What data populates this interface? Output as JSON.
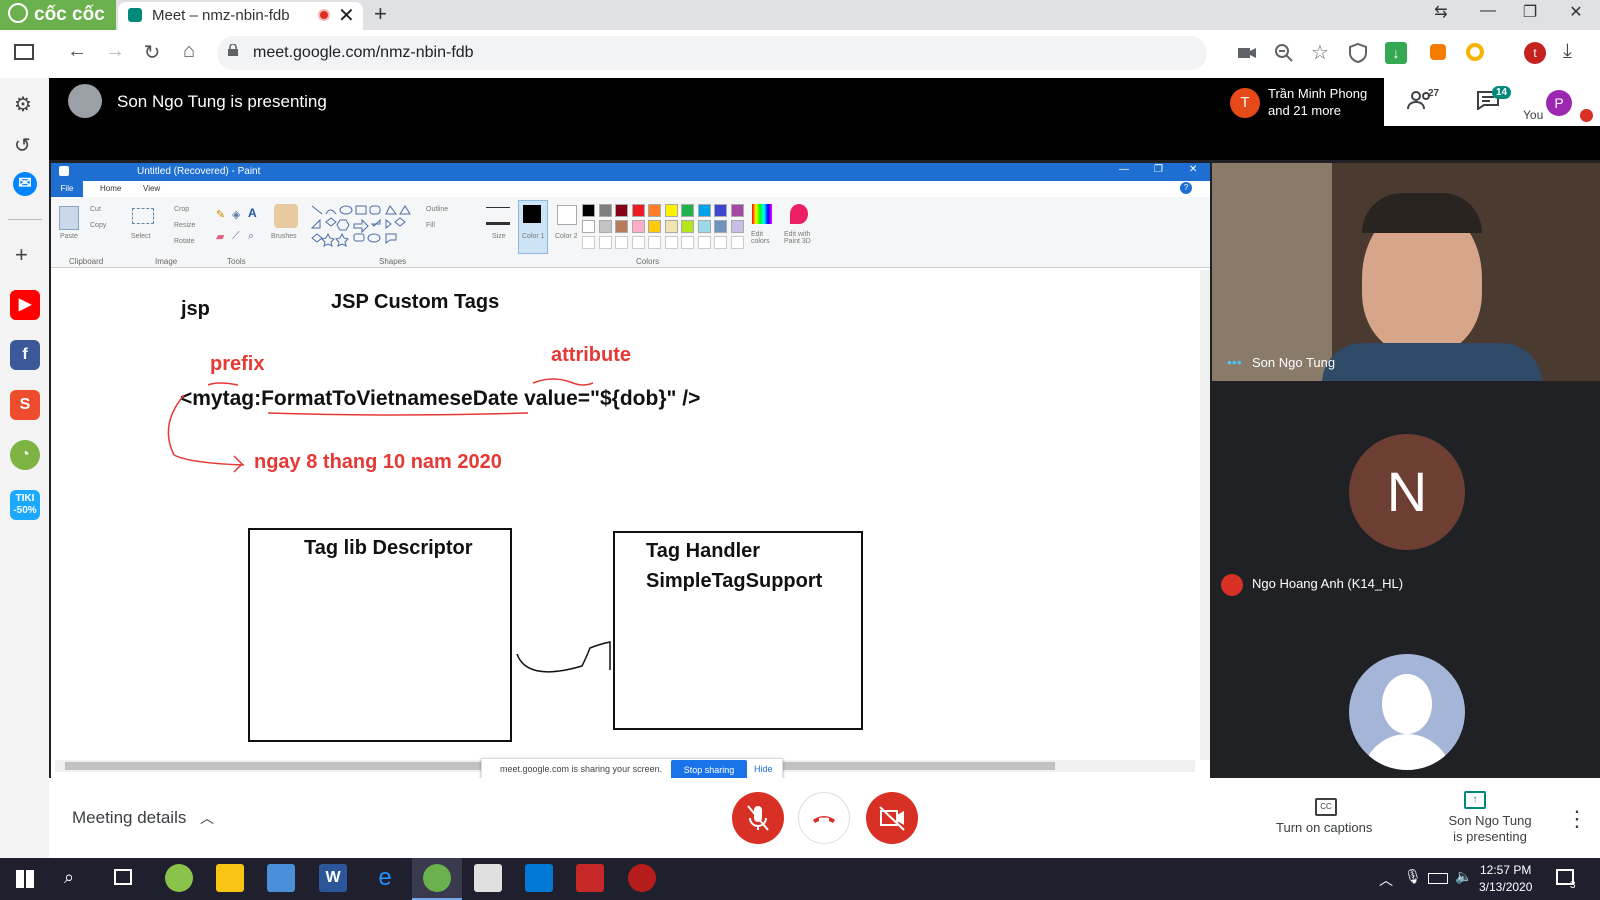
{
  "browser": {
    "brand": "cốc cốc",
    "tab_title": "Meet – nmz-nbin-fdb",
    "url": "meet.google.com/nmz-nbin-fdb",
    "accent": "#6ab04c"
  },
  "meet": {
    "presenting_text": "Son Ngo Tung is presenting",
    "chip_line1": "Trần Minh Phong",
    "chip_line2": "and 21 more",
    "chip_initial": "T",
    "people_count": "27",
    "chat_count": "14",
    "you_label": "You",
    "you_initial": "P",
    "participants": [
      {
        "name": "Son Ngo Tung"
      },
      {
        "name": "Ngo Hoang Anh (K14_HL)",
        "initial": "N"
      }
    ],
    "meeting_details": "Meeting details",
    "captions_label": "Turn on captions",
    "presenting_label_1": "Son Ngo Tung",
    "presenting_label_2": "is presenting",
    "mic_color": "#d93025"
  },
  "paint": {
    "title": "Untitled (Recovered) - Paint",
    "menus": [
      "File",
      "Home",
      "View"
    ],
    "groups": [
      "Clipboard",
      "Image",
      "Tools",
      "Shapes",
      "Colors"
    ],
    "tools": {
      "paste": "Paste",
      "cut": "Cut",
      "copy": "Copy",
      "select": "Select",
      "crop": "Crop",
      "resize": "Resize",
      "rotate": "Rotate",
      "brushes": "Brushes",
      "outline": "Outline",
      "fill": "Fill",
      "size": "Size",
      "color1": "Color 1",
      "color2": "Color 2",
      "edit_colors": "Edit colors",
      "paint3d": "Edit with Paint 3D"
    },
    "palette": [
      "#000000",
      "#7f7f7f",
      "#880015",
      "#ed1c24",
      "#ff7f27",
      "#fff200",
      "#22b14c",
      "#00a2e8",
      "#3f48cc",
      "#a349a4",
      "#ffffff",
      "#c3c3c3",
      "#b97a57",
      "#ffaec9",
      "#ffc90e",
      "#efe4b0",
      "#b5e61d",
      "#99d9ea",
      "#7092be",
      "#c8bfe7"
    ],
    "canvas": {
      "jsp": "jsp",
      "heading": "JSP Custom Tags",
      "prefix": "prefix",
      "attribute": "attribute",
      "code_start": "<mytag:",
      "code_name": "FormatToVietnameseDate",
      "code_end": " value=\"${dob}\" />",
      "result": "ngay 8 thang 10 nam 2020",
      "box1": "Tag lib Descriptor",
      "box2_line1": "Tag Handler",
      "box2_line2": "SimpleTagSupport"
    },
    "share_text": "meet.google.com is sharing your screen.",
    "stop_sharing": "Stop sharing",
    "hide": "Hide"
  },
  "taskbar": {
    "time": "12:57 PM",
    "date": "3/13/2020",
    "notifications": "3"
  },
  "sidebar": {
    "tiki_line1": "TIKI",
    "tiki_line2": "-50%"
  }
}
